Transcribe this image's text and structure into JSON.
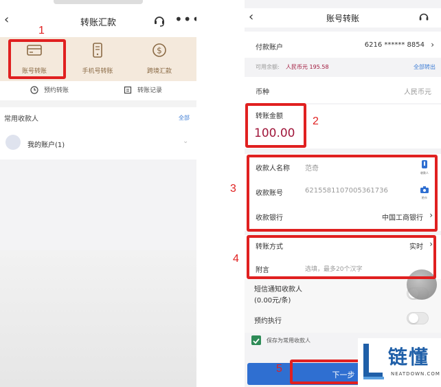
{
  "left": {
    "title": "转账汇款",
    "quick_actions": [
      {
        "label": "账号转账",
        "icon": "card-icon"
      },
      {
        "label": "手机号转账",
        "icon": "phone-icon"
      },
      {
        "label": "跨境汇款",
        "icon": "dollar-coin-icon"
      }
    ],
    "sub_actions": [
      {
        "label": "预约转账",
        "icon": "clock-icon"
      },
      {
        "label": "转账记录",
        "icon": "record-icon"
      }
    ],
    "contacts_heading": "常用收款人",
    "contacts_all": "全部",
    "my_account": "我的账户(1)"
  },
  "right": {
    "title": "账号转账",
    "payer_label": "付款账户",
    "payer_value": "6216 ****** 8854",
    "balance_label": "可用余额:",
    "balance_value": "人民币元 195.58",
    "transfer_all": "全部转出",
    "currency_label": "币种",
    "currency_value": "人民币元",
    "amount_label": "转账金额",
    "amount_value": "100.00",
    "payee_name_label": "收款人名称",
    "payee_name_value": "范奇",
    "payee_name_icon_text": "收款人",
    "account_label": "收款账号",
    "account_value": "6215581107005361736",
    "account_icon_text": "拍卡",
    "bank_label": "收款银行",
    "bank_value": "中国工商银行",
    "method_label": "转账方式",
    "method_value": "实时",
    "note_label": "附言",
    "note_placeholder": "选填，最多20个汉字",
    "sms_label_1": "短信通知收款人",
    "sms_label_2": "(0.00元/条)",
    "scheduled_label": "预约执行",
    "save_payee_label": "保存为常用收款人",
    "next_button": "下一步"
  },
  "annotations": [
    "1",
    "2",
    "3",
    "4",
    "5"
  ],
  "watermark": {
    "cn": "链懂",
    "en": "NEATDOWN.COM"
  },
  "colors": {
    "accent_red": "#e02020",
    "amount_color": "#a0163a",
    "link_blue": "#3b7bd4",
    "quick_bg": "#f4e9dc",
    "button_blue": "#2f6fd1"
  }
}
